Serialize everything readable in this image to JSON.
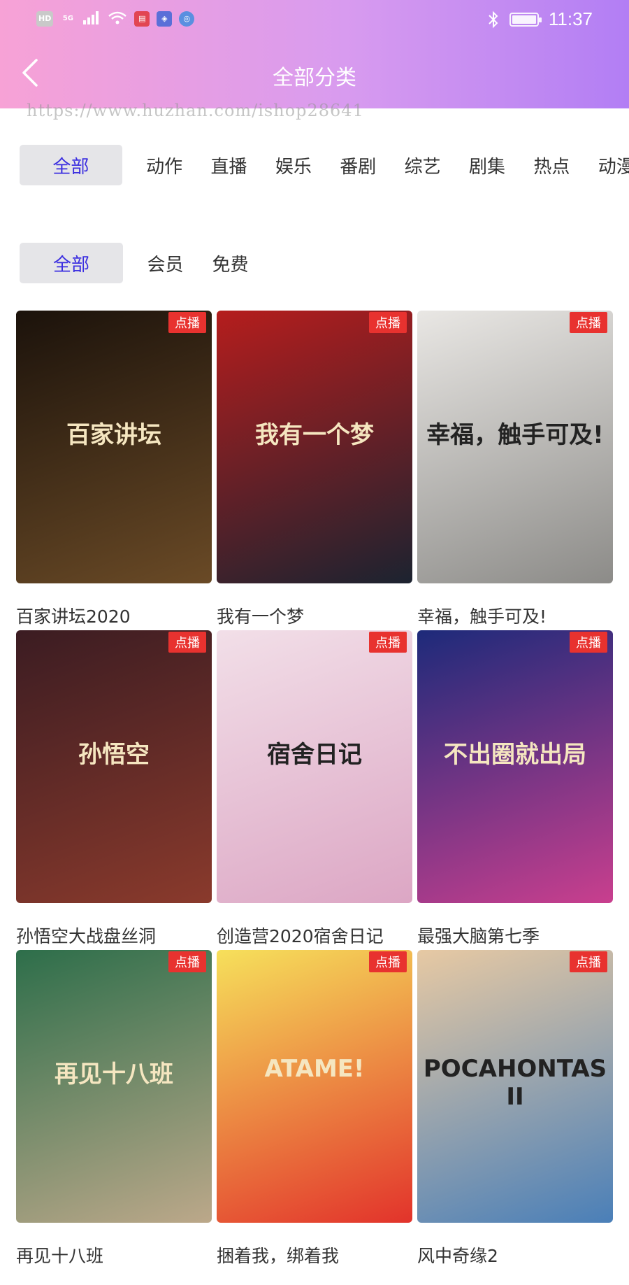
{
  "status_bar": {
    "left_icons": [
      "HD",
      "5G",
      "signal-icon",
      "wifi-icon",
      "app-red-icon",
      "shield-icon",
      "browser-icon"
    ],
    "time": "11:37"
  },
  "header": {
    "title": "全部分类",
    "watermark": "https://www.huzhan.com/ishop28641"
  },
  "category_tabs": [
    "全部",
    "动作",
    "直播",
    "娱乐",
    "番剧",
    "综艺",
    "剧集",
    "热点",
    "动漫"
  ],
  "filter_tabs": [
    "全部",
    "会员",
    "免费"
  ],
  "badge_label": "点播",
  "videos": [
    {
      "title": "百家讲坛2020",
      "poster_text": "百家讲坛",
      "colors": [
        "#1b120b",
        "#6a4a26"
      ]
    },
    {
      "title": "我有一个梦",
      "poster_text": "我有一个梦",
      "colors": [
        "#b51d1d",
        "#1c2330"
      ]
    },
    {
      "title": "幸福，触手可及!",
      "poster_text": "幸福，触手可及!",
      "colors": [
        "#e9e7e4",
        "#8c8b88"
      ]
    },
    {
      "title": "孙悟空大战盘丝洞",
      "poster_text": "孙悟空",
      "colors": [
        "#3b1c22",
        "#8a3a2c"
      ]
    },
    {
      "title": "创造营2020宿舍日记",
      "poster_text": "宿舍日记",
      "colors": [
        "#f2dfe8",
        "#dca6c4"
      ]
    },
    {
      "title": "最强大脑第七季",
      "poster_text": "不出圈就出局",
      "colors": [
        "#1d2a7a",
        "#c93f8e"
      ]
    },
    {
      "title": "再见十八班",
      "poster_text": "再见十八班",
      "colors": [
        "#2d6e4a",
        "#bca88a"
      ]
    },
    {
      "title": "捆着我，绑着我",
      "poster_text": "ATAME!",
      "colors": [
        "#f6e05b",
        "#e2332b"
      ]
    },
    {
      "title": "风中奇缘2",
      "poster_text": "POCAHONTAS II",
      "colors": [
        "#e7c9a3",
        "#4a7fb8"
      ]
    }
  ],
  "colors": {
    "header_gradient": [
      "#f7a2d6",
      "#b27ef4"
    ],
    "active_tab_text": "#3b2ee0",
    "badge": "#e8322f"
  }
}
